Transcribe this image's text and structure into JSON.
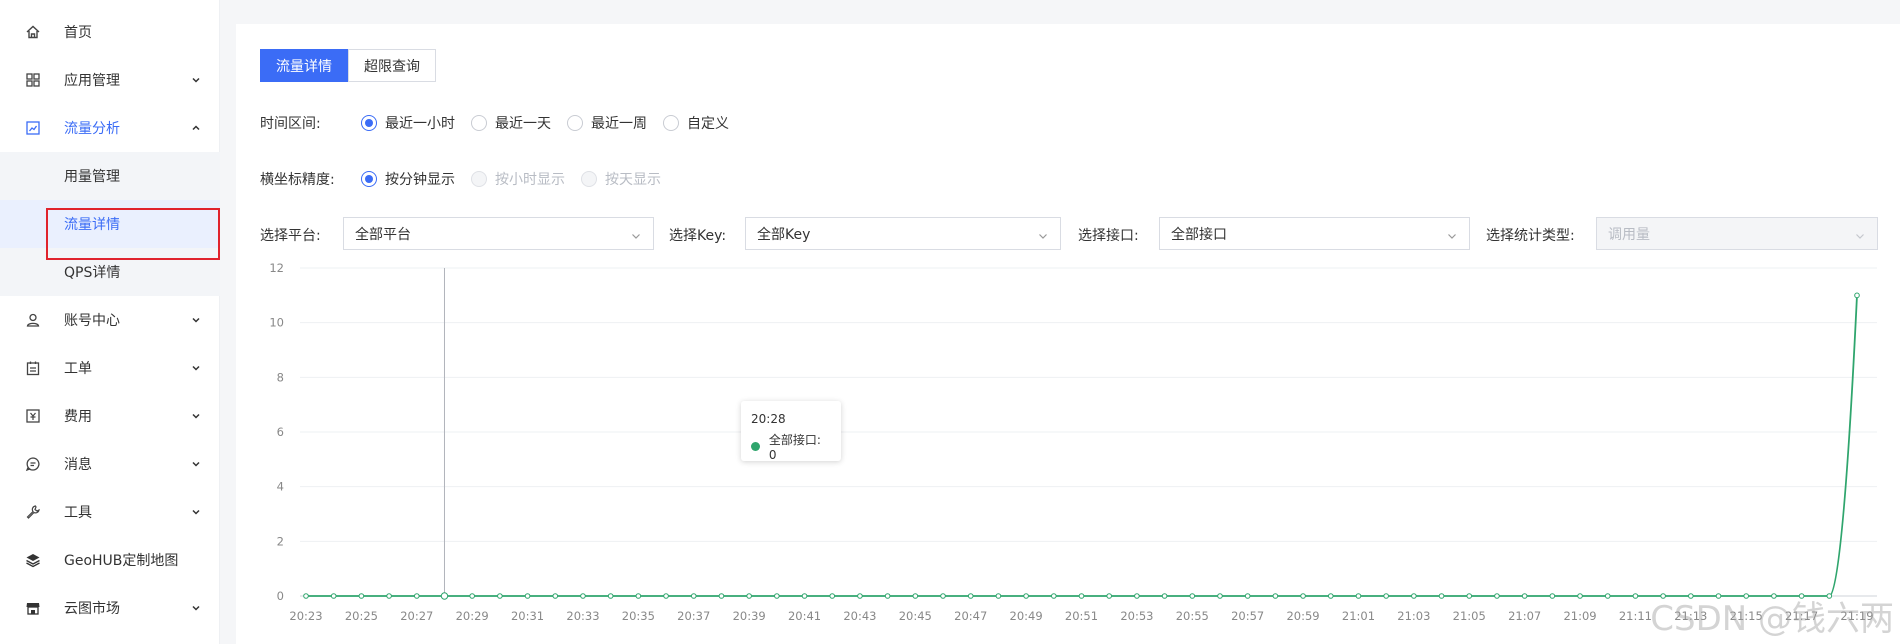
{
  "sidebar": {
    "items": [
      {
        "label": "首页",
        "icon": "home-icon",
        "has_chevron": false
      },
      {
        "label": "应用管理",
        "icon": "grid-icon",
        "has_chevron": true,
        "chevron": "down"
      },
      {
        "label": "流量分析",
        "icon": "chart-box-icon",
        "has_chevron": true,
        "chevron": "up",
        "active": true
      },
      {
        "label": "账号中心",
        "icon": "user-icon",
        "has_chevron": true,
        "chevron": "down"
      },
      {
        "label": "工单",
        "icon": "clipboard-icon",
        "has_chevron": true,
        "chevron": "down"
      },
      {
        "label": "费用",
        "icon": "yen-icon",
        "has_chevron": true,
        "chevron": "down"
      },
      {
        "label": "消息",
        "icon": "message-icon",
        "has_chevron": true,
        "chevron": "down"
      },
      {
        "label": "工具",
        "icon": "wrench-icon",
        "has_chevron": true,
        "chevron": "down"
      },
      {
        "label": "GeoHUB定制地图",
        "icon": "layers-icon",
        "has_chevron": false
      },
      {
        "label": "云图市场",
        "icon": "store-icon",
        "has_chevron": true,
        "chevron": "down"
      }
    ],
    "subitems": [
      {
        "label": "用量管理"
      },
      {
        "label": "流量详情",
        "selected": true
      },
      {
        "label": "QPS详情"
      }
    ]
  },
  "tabs": [
    {
      "label": "流量详情",
      "active": true
    },
    {
      "label": "超限查询",
      "active": false
    }
  ],
  "time_range": {
    "label": "时间区间:",
    "options": [
      {
        "label": "最近一小时",
        "checked": true
      },
      {
        "label": "最近一天",
        "checked": false
      },
      {
        "label": "最近一周",
        "checked": false
      },
      {
        "label": "自定义",
        "checked": false
      }
    ]
  },
  "precision": {
    "label": "横坐标精度:",
    "options": [
      {
        "label": "按分钟显示",
        "checked": true,
        "disabled": false
      },
      {
        "label": "按小时显示",
        "checked": false,
        "disabled": true
      },
      {
        "label": "按天显示",
        "checked": false,
        "disabled": true
      }
    ]
  },
  "filters": {
    "platform": {
      "label": "选择平台:",
      "value": "全部平台"
    },
    "key": {
      "label": "选择Key:",
      "value": "全部Key"
    },
    "api": {
      "label": "选择接口:",
      "value": "全部接口"
    },
    "stat_type": {
      "label": "选择统计类型:",
      "value": "调用量",
      "disabled": true
    }
  },
  "tooltip": {
    "time": "20:28",
    "series": "全部接口",
    "value_text": "全部接口: 0"
  },
  "watermark": "CSDN @钱六两",
  "colors": {
    "accent": "#3b6cf6",
    "series": "#2fa56d",
    "highlight_border": "#e0232d"
  },
  "chart_data": {
    "type": "line",
    "x": [
      "20:23",
      "20:24",
      "20:25",
      "20:26",
      "20:27",
      "20:28",
      "20:29",
      "20:30",
      "20:31",
      "20:32",
      "20:33",
      "20:34",
      "20:35",
      "20:36",
      "20:37",
      "20:38",
      "20:39",
      "20:40",
      "20:41",
      "20:42",
      "20:43",
      "20:44",
      "20:45",
      "20:46",
      "20:47",
      "20:48",
      "20:49",
      "20:50",
      "20:51",
      "20:52",
      "20:53",
      "20:54",
      "20:55",
      "20:56",
      "20:57",
      "20:58",
      "20:59",
      "21:00",
      "21:01",
      "21:02",
      "21:03",
      "21:04",
      "21:05",
      "21:06",
      "21:07",
      "21:08",
      "21:09",
      "21:10",
      "21:11",
      "21:12",
      "21:13",
      "21:14",
      "21:15",
      "21:16",
      "21:17",
      "21:18",
      "21:19"
    ],
    "x_tick_labels": [
      "20:23",
      "20:25",
      "20:27",
      "20:29",
      "20:31",
      "20:33",
      "20:35",
      "20:37",
      "20:39",
      "20:41",
      "20:43",
      "20:45",
      "20:47",
      "20:49",
      "20:51",
      "20:53",
      "20:55",
      "20:57",
      "20:59",
      "21:01",
      "21:03",
      "21:05",
      "21:07",
      "21:09",
      "21:11",
      "21:13",
      "21:15",
      "21:17",
      "21:19"
    ],
    "series": [
      {
        "name": "全部接口",
        "values": [
          0,
          0,
          0,
          0,
          0,
          0,
          0,
          0,
          0,
          0,
          0,
          0,
          0,
          0,
          0,
          0,
          0,
          0,
          0,
          0,
          0,
          0,
          0,
          0,
          0,
          0,
          0,
          0,
          0,
          0,
          0,
          0,
          0,
          0,
          0,
          0,
          0,
          0,
          0,
          0,
          0,
          0,
          0,
          0,
          0,
          0,
          0,
          0,
          0,
          0,
          0,
          0,
          0,
          0,
          0,
          0,
          11
        ]
      }
    ],
    "y_ticks": [
      0,
      2,
      4,
      6,
      8,
      10,
      12
    ],
    "ylim": [
      0,
      12
    ],
    "grid": true,
    "hover_x": "20:28"
  }
}
